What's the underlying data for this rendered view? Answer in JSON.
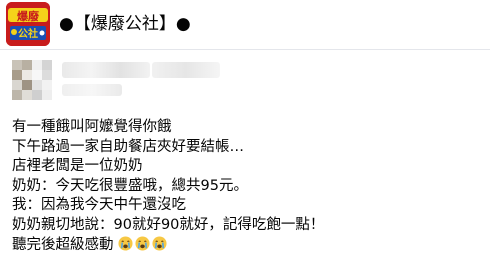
{
  "page": {
    "name_text": "●【爆廢公社】●",
    "logo_icon": "bafei-gongshe-logo-icon"
  },
  "post": {
    "author_name": "",
    "lines": [
      "有一種餓叫阿嬤覺得你餓",
      "下午路過一家自助餐店夾好要結帳…",
      "店裡老闆是一位奶奶",
      "奶奶：今天吃很豐盛哦，總共95元。",
      "我：因為我今天中午還沒吃",
      "奶奶親切地說：90就好90就好，記得吃飽一點！",
      "聽完後超級感動"
    ],
    "reaction_emojis": [
      "crying-face-icon",
      "crying-face-icon",
      "crying-face-icon"
    ]
  },
  "colors": {
    "logo_red": "#c81c1c",
    "logo_yellow": "#f5d21a",
    "logo_blue": "#1a4fb5",
    "text": "#050505",
    "divider": "#e4e6eb",
    "emoji_yellow": "#f7c844"
  }
}
